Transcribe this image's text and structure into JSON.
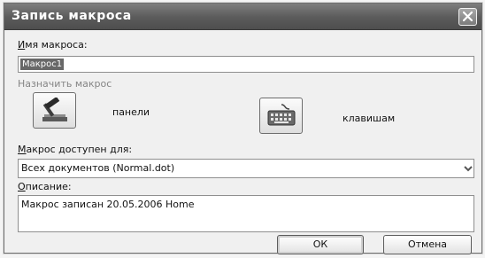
{
  "window": {
    "title": "Запись макроса",
    "close_icon": "close-icon"
  },
  "macro_name": {
    "label_accel": "И",
    "label_rest": "мя макроса:",
    "value": "Макрос1"
  },
  "assign": {
    "label": "Назначить макрос",
    "toolbar_button": {
      "icon": "hammer-icon",
      "label": "панели"
    },
    "keyboard_button": {
      "icon": "keyboard-icon",
      "label": "клавишам"
    }
  },
  "store_in": {
    "label_accel": "М",
    "label_rest": "акрос доступен для:",
    "value": "Всех документов (Normal.dot)",
    "arrow_icon": "chevron-down-icon"
  },
  "description": {
    "label_accel": "О",
    "label_rest": "писание:",
    "value": "Макрос записан 20.05.2006 Home"
  },
  "buttons": {
    "ok": "ОК",
    "cancel": "Отмена"
  }
}
